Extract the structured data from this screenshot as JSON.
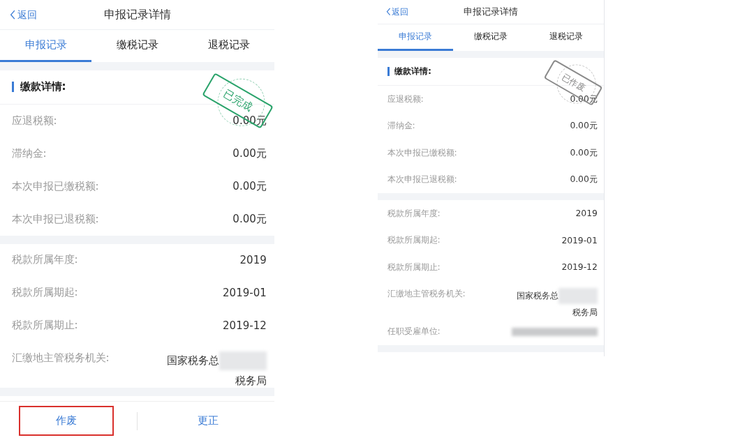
{
  "phones": [
    {
      "back": "返回",
      "title": "申报记录详情",
      "tabs": [
        {
          "label": "申报记录",
          "selected": true
        },
        {
          "label": "缴税记录",
          "selected": false
        },
        {
          "label": "退税记录",
          "selected": false
        }
      ],
      "section_title": "缴款详情:",
      "stamp": {
        "text": "已完成",
        "completed": true
      },
      "groups": [
        [
          {
            "kind": "plain",
            "label": "应退税额:",
            "value": "0.00元"
          },
          {
            "kind": "plain",
            "label": "滞纳金:",
            "value": "0.00元"
          },
          {
            "kind": "plain",
            "label": "本次申报已缴税额:",
            "value": "0.00元"
          },
          {
            "kind": "plain",
            "label": "本次申报已退税额:",
            "value": "0.00元"
          }
        ],
        [
          {
            "kind": "plain",
            "label": "税款所属年度:",
            "value": "2019"
          },
          {
            "kind": "plain",
            "label": "税款所属期起:",
            "value": "2019-01"
          },
          {
            "kind": "plain",
            "label": "税款所属期止:",
            "value": "2019-12"
          },
          {
            "kind": "authority",
            "label": "汇缴地主管税务机关:",
            "value": "国家税务总",
            "value_2": "税务局"
          }
        ]
      ],
      "buttons": [
        {
          "label": "作废",
          "highlighted": true
        },
        {
          "label": "更正",
          "highlighted": false
        }
      ]
    },
    {
      "back": "返回",
      "title": "申报记录详情",
      "tabs": [
        {
          "label": "申报记录",
          "selected": true
        },
        {
          "label": "缴税记录",
          "selected": false
        },
        {
          "label": "退税记录",
          "selected": false
        }
      ],
      "section_title": "缴款详情:",
      "stamp": {
        "text": "已作废",
        "completed": false
      },
      "groups": [
        [
          {
            "kind": "plain",
            "label": "应退税额:",
            "value": "0.00元"
          },
          {
            "kind": "plain",
            "label": "滞纳金:",
            "value": "0.00元"
          },
          {
            "kind": "plain",
            "label": "本次申报已缴税额:",
            "value": "0.00元"
          },
          {
            "kind": "plain",
            "label": "本次申报已退税额:",
            "value": "0.00元"
          }
        ],
        [
          {
            "kind": "plain",
            "label": "税款所属年度:",
            "value": "2019"
          },
          {
            "kind": "plain",
            "label": "税款所属期起:",
            "value": "2019-01"
          },
          {
            "kind": "plain",
            "label": "税款所属期止:",
            "value": "2019-12"
          },
          {
            "kind": "authority",
            "label": "汇缴地主管税务机关:",
            "value": "国家税务总",
            "value_2": "税务局"
          },
          {
            "kind": "hidden",
            "label": "任职受雇单位:"
          }
        ]
      ]
    }
  ]
}
